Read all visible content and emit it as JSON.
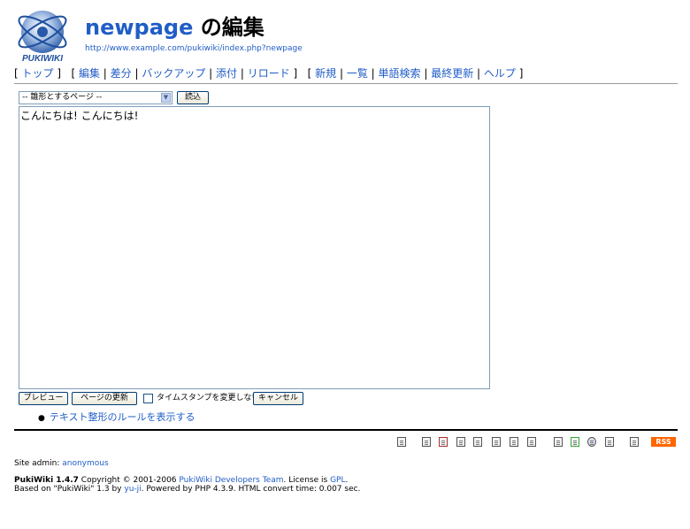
{
  "header": {
    "logo_text": "PUKIWIKI",
    "page_name": "newpage",
    "title_suffix": " の編集",
    "url": "http://www.example.com/pukiwiki/index.php?newpage"
  },
  "nav": {
    "top": "トップ",
    "edit": "編集",
    "diff": "差分",
    "backup": "バックアップ",
    "attach": "添付",
    "reload": "リロード",
    "new": "新規",
    "list": "一覧",
    "search": "単語検索",
    "recent": "最終更新",
    "help": "ヘルプ"
  },
  "form": {
    "template_select": "-- 雛形とするページ --",
    "load_button": "読込",
    "editor_text": "こんにちは! こんにちは!",
    "preview_button": "プレビュー",
    "update_button": "ページの更新",
    "timestamp_label": "タイムスタンプを変更しない",
    "timestamp_checked": false,
    "cancel_button": "キャンセル",
    "rules_link": "テキスト整形のルールを表示する"
  },
  "toolbar": {
    "rss_label": "RSS"
  },
  "footer": {
    "site_admin_label": "Site admin: ",
    "site_admin": "anonymous",
    "version": "PukiWiki 1.4.7",
    "copyright": " Copyright © 2001-2006 ",
    "team": "PukiWiki Developers Team",
    "license_label": ". License is ",
    "license": "GPL",
    "license_end": ".",
    "based_on": "Based on \"PukiWiki\" 1.3 by ",
    "based_author": "yu-ji",
    "powered": ". Powered by PHP 4.3.9. HTML convert time: 0.007 sec."
  }
}
